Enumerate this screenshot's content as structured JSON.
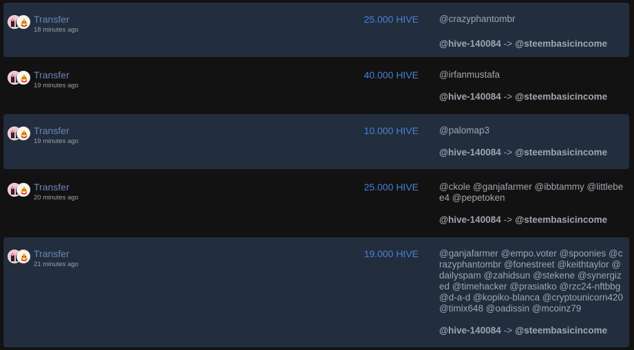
{
  "feed": [
    {
      "type": "Transfer",
      "time": "18 minutes ago",
      "amount": "25.000 HIVE",
      "recipients": [
        "@crazyphantombr"
      ],
      "from": "@hive-140084",
      "arrow": "->",
      "to": "@steembasicincome"
    },
    {
      "type": "Transfer",
      "time": "19 minutes ago",
      "amount": "40.000 HIVE",
      "recipients": [
        "@irfanmustafa"
      ],
      "from": "@hive-140084",
      "arrow": "->",
      "to": "@steembasicincome"
    },
    {
      "type": "Transfer",
      "time": "19 minutes ago",
      "amount": "10.000 HIVE",
      "recipients": [
        "@palomap3"
      ],
      "from": "@hive-140084",
      "arrow": "->",
      "to": "@steembasicincome"
    },
    {
      "type": "Transfer",
      "time": "20 minutes ago",
      "amount": "25.000 HIVE",
      "recipients": [
        "@ckole",
        "@ganjafarmer",
        "@ibbtammy",
        "@littlebee4",
        "@pepetoken"
      ],
      "from": "@hive-140084",
      "arrow": "->",
      "to": "@steembasicincome"
    },
    {
      "type": "Transfer",
      "time": "21 minutes ago",
      "amount": "19.000 HIVE",
      "recipients": [
        "@ganjafarmer",
        "@empo.voter",
        "@spoonies",
        "@crazyphantombr",
        "@fonestreet",
        "@keithtaylor",
        "@dailyspam",
        "@zahidsun",
        "@stekene",
        "@synergized",
        "@timehacker",
        "@prasiatko",
        "@rzc24-nftbbg",
        "@d-a-d",
        "@kopiko-blanca",
        "@cryptounicorn420",
        "@timix648",
        "@oadissin",
        "@mcoinz79"
      ],
      "from": "@hive-140084",
      "arrow": "->",
      "to": "@steembasicincome"
    }
  ]
}
